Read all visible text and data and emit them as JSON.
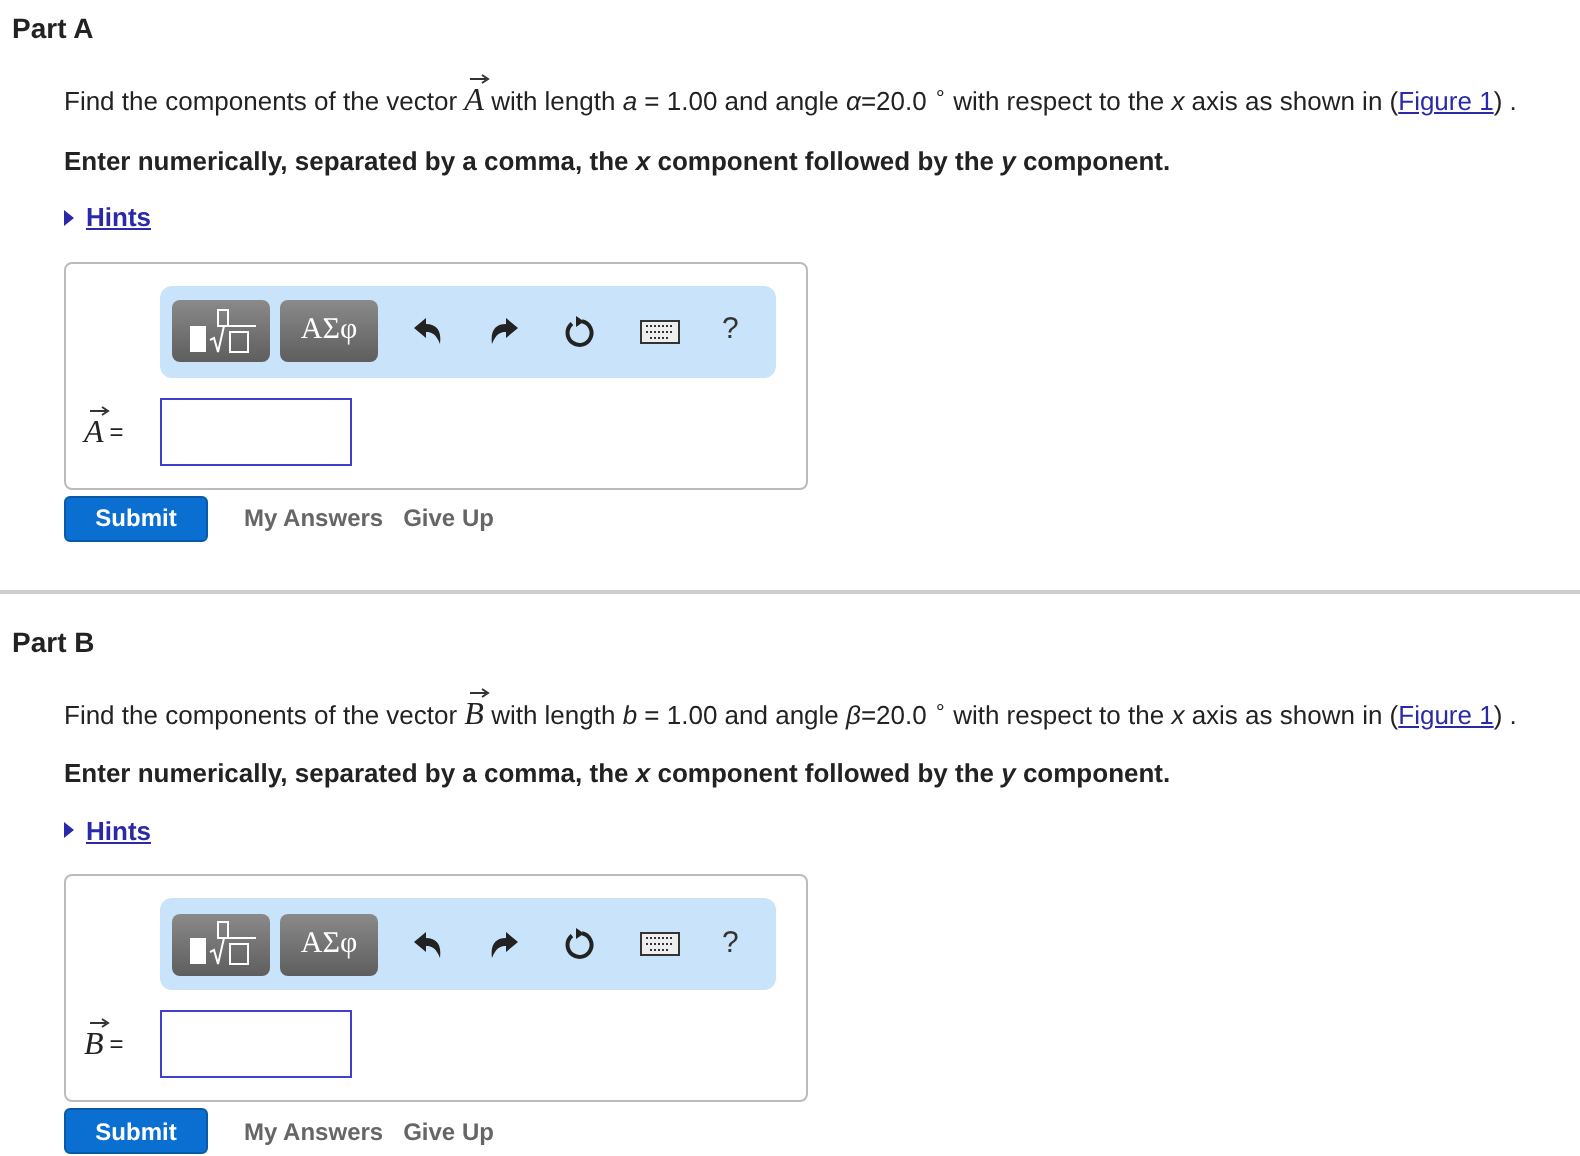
{
  "parts": [
    {
      "title": "Part A",
      "prompt_before": "Find the components of the vector ",
      "vector": "A",
      "prompt_middle": " with length *a* = 1.00 and angle *α*=20.0 $^{∘}$ with respect to the *x* axis as shown in (",
      "figure_link": "Figure 1",
      "prompt_after": ") .",
      "instruction": "Enter numerically, separated by a comma, the *x* component followed by the *y* component.",
      "hints": "Hints",
      "symbols_button": "ΑΣφ",
      "help_button": "?",
      "answer_vector": "A",
      "answer_label": "=",
      "submit": "Submit",
      "links": [
        "My Answers",
        "Give Up"
      ]
    },
    {
      "title": "Part B",
      "prompt_before": "Find the components of the vector ",
      "vector": "B",
      "prompt_middle": " with length *b* = 1.00 and angle *β*=20.0 $^{∘}$ with respect to the *x* axis as shown in (",
      "figure_link": "Figure 1",
      "prompt_after": ") .",
      "instruction": "Enter numerically, separated by a comma, the *x* component followed by the *y* component.",
      "hints": "Hints",
      "symbols_button": "ΑΣφ",
      "help_button": "?",
      "answer_vector": "B",
      "answer_label": "=",
      "submit": "Submit",
      "links": [
        "My Answers",
        "Give Up"
      ]
    }
  ]
}
